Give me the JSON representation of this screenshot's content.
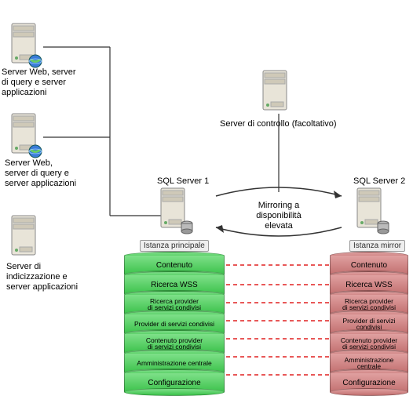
{
  "servers": {
    "web1_label": "Server Web, server\ndi query e server\napplicazioni",
    "web2_label": "Server Web,\nserver di query e\nserver applicazioni",
    "index_label": "Server di\nindicizzazione e\nserver applicazioni",
    "witness_label": "Server di controllo (facoltativo)",
    "sql1_label": "SQL Server 1",
    "sql2_label": "SQL Server 2"
  },
  "mirroring_label": "Mirroring a\ndisponibilità elevata",
  "instance_principal": "Istanza principale",
  "instance_mirror": "Istanza mirror",
  "databases": {
    "d0": "Contenuto",
    "d1": "Ricerca WSS",
    "d2": "Ricerca provider\ndi servizi condivisi",
    "d3": "Provider di servizi condivisi",
    "d4": "Contenuto provider\ndi servizi condivisi",
    "d5": "Amministrazione centrale",
    "d6": "Configurazione"
  }
}
